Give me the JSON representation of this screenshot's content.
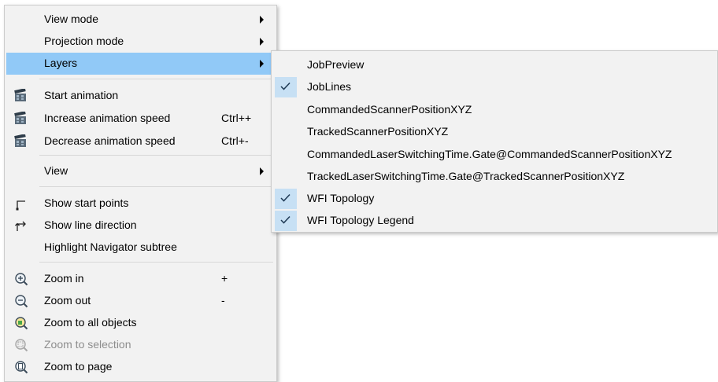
{
  "context_menu": {
    "items": [
      {
        "label": "View mode",
        "submenu": true
      },
      {
        "label": "Projection mode",
        "submenu": true
      },
      {
        "label": "Layers",
        "submenu": true,
        "highlighted": true
      },
      {
        "label": "Start animation",
        "icon": "film-clapper-icon"
      },
      {
        "label": "Increase animation speed",
        "shortcut": "Ctrl++",
        "icon": "film-clapper-icon"
      },
      {
        "label": "Decrease animation speed",
        "shortcut": "Ctrl+-",
        "icon": "film-clapper-icon"
      },
      {
        "label": "View",
        "submenu": true
      },
      {
        "label": "Show start points",
        "icon": "start-point-icon"
      },
      {
        "label": "Show line direction",
        "icon": "line-direction-icon"
      },
      {
        "label": "Highlight Navigator subtree"
      },
      {
        "label": "Zoom in",
        "shortcut": "+",
        "icon": "zoom-in-icon"
      },
      {
        "label": "Zoom out",
        "shortcut": "-",
        "icon": "zoom-out-icon"
      },
      {
        "label": "Zoom to all objects",
        "icon": "zoom-all-icon"
      },
      {
        "label": "Zoom to selection",
        "icon": "zoom-selection-icon",
        "disabled": true
      },
      {
        "label": "Zoom to page",
        "icon": "zoom-page-icon"
      }
    ]
  },
  "layers_menu": {
    "items": [
      {
        "label": "JobPreview",
        "checked": false
      },
      {
        "label": "JobLines",
        "checked": true
      },
      {
        "label": "CommandedScannerPositionXYZ",
        "checked": false
      },
      {
        "label": "TrackedScannerPositionXYZ",
        "checked": false
      },
      {
        "label": "CommandedLaserSwitchingTime.Gate@CommandedScannerPositionXYZ",
        "checked": false
      },
      {
        "label": "TrackedLaserSwitchingTime.Gate@TrackedScannerPositionXYZ",
        "checked": false
      },
      {
        "label": "WFI Topology",
        "checked": true
      },
      {
        "label": "WFI Topology Legend",
        "checked": true
      }
    ]
  },
  "colors": {
    "highlight": "#91c9f7",
    "check_background": "#c7e0f4",
    "menu_background": "#f2f2f2"
  }
}
